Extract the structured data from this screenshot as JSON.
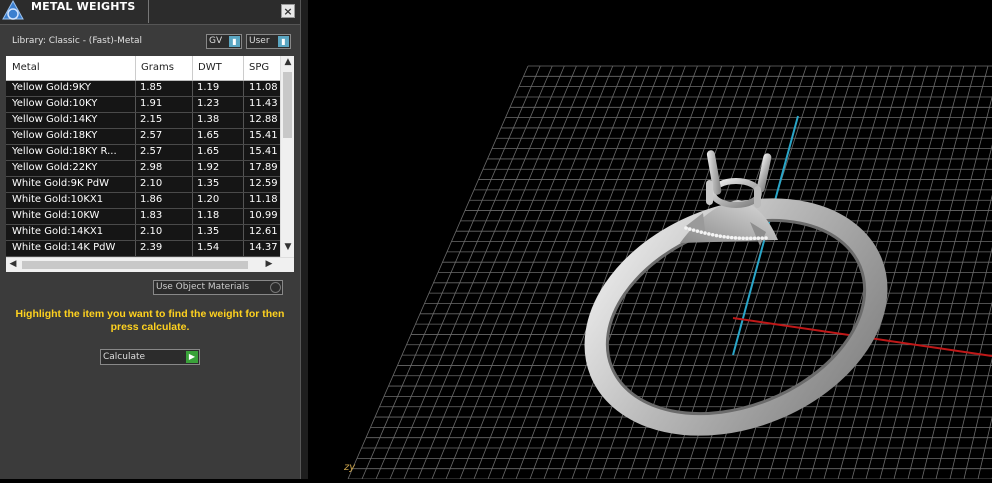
{
  "panel": {
    "title": "METAL WEIGHTS",
    "close_glyph": "×",
    "library_label": "Library: Classic - (Fast)-Metal",
    "gv_label": "GV",
    "user_label": "User",
    "columns": [
      "Metal",
      "Grams",
      "DWT",
      "SPG"
    ],
    "rows": [
      [
        "Yellow Gold:9KY",
        "1.85",
        "1.19",
        "11.08"
      ],
      [
        "Yellow Gold:10KY",
        "1.91",
        "1.23",
        "11.43"
      ],
      [
        "Yellow Gold:14KY",
        "2.15",
        "1.38",
        "12.88"
      ],
      [
        "Yellow Gold:18KY",
        "2.57",
        "1.65",
        "15.41"
      ],
      [
        "Yellow Gold:18KY R...",
        "2.57",
        "1.65",
        "15.41"
      ],
      [
        "Yellow Gold:22KY",
        "2.98",
        "1.92",
        "17.89"
      ],
      [
        "White Gold:9K PdW",
        "2.10",
        "1.35",
        "12.59"
      ],
      [
        "White Gold:10KX1",
        "1.86",
        "1.20",
        "11.18"
      ],
      [
        "White Gold:10KW",
        "1.83",
        "1.18",
        "10.99"
      ],
      [
        "White Gold:14KX1",
        "2.10",
        "1.35",
        "12.61"
      ],
      [
        "White Gold:14K PdW",
        "2.39",
        "1.54",
        "14.37"
      ]
    ],
    "use_object_materials_label": "Use Object Materials",
    "hint": "Highlight the item you want to find the weight for then press calculate.",
    "calculate_label": "Calculate"
  },
  "viewport": {
    "axis_label": "zy",
    "grid_color": "#6a6a6a",
    "x_axis_color": "#c01818",
    "y_axis_color": "#2aa6c8"
  },
  "colors": {
    "hint": "#ffd21f",
    "panel_bg": "#3b3b3b",
    "calc_go": "#3aa23a",
    "toggle_accent": "#5aa6c2"
  }
}
